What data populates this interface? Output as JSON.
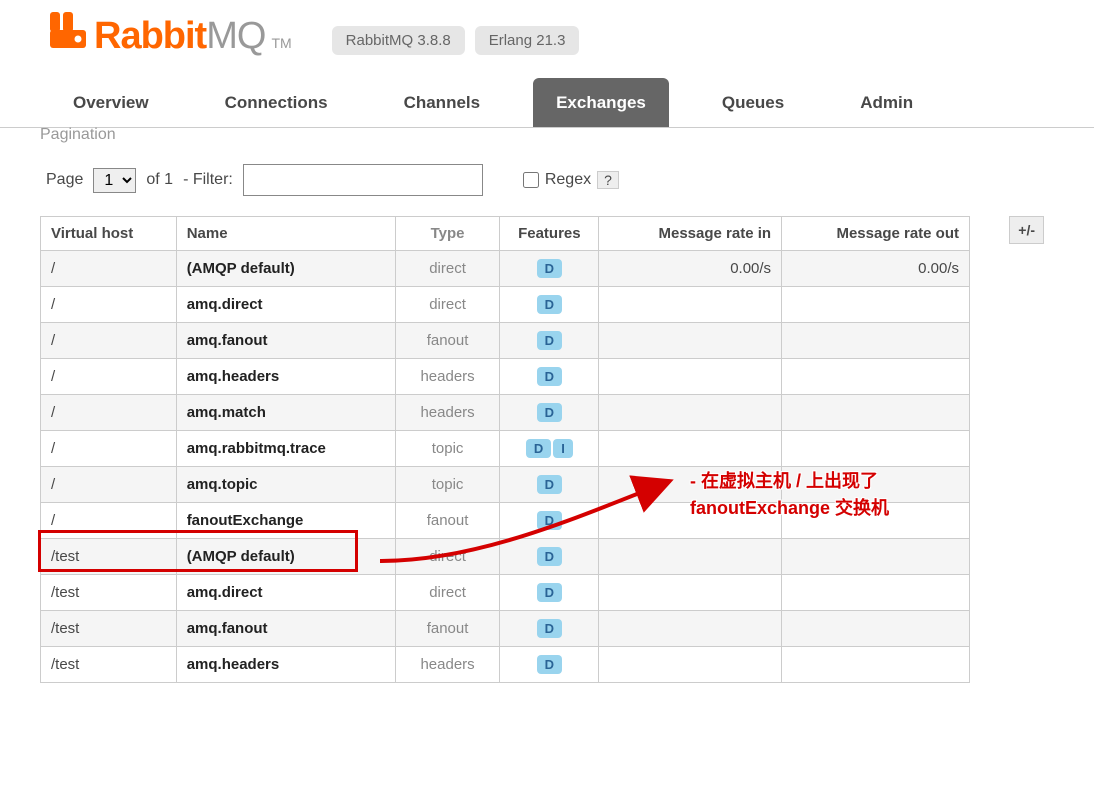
{
  "logo": {
    "rabbit": "Rabbit",
    "mq": "MQ",
    "tm": "TM"
  },
  "versions": {
    "rabbitmq": "RabbitMQ 3.8.8",
    "erlang": "Erlang 21.3"
  },
  "tabs": {
    "overview": "Overview",
    "connections": "Connections",
    "channels": "Channels",
    "exchanges": "Exchanges",
    "queues": "Queues",
    "admin": "Admin"
  },
  "section": "Pagination",
  "pagination": {
    "page_label": "Page",
    "page_value": "1",
    "of_label": "of 1",
    "filter_label": "- Filter:",
    "filter_value": "",
    "regex_label": "Regex",
    "help": "?"
  },
  "table": {
    "plus_minus": "+/-",
    "headers": {
      "vhost": "Virtual host",
      "name": "Name",
      "type": "Type",
      "features": "Features",
      "rate_in": "Message rate in",
      "rate_out": "Message rate out"
    },
    "rows": [
      {
        "vhost": "/",
        "name": "(AMQP default)",
        "type": "direct",
        "features": [
          "D"
        ],
        "rate_in": "0.00/s",
        "rate_out": "0.00/s"
      },
      {
        "vhost": "/",
        "name": "amq.direct",
        "type": "direct",
        "features": [
          "D"
        ],
        "rate_in": "",
        "rate_out": ""
      },
      {
        "vhost": "/",
        "name": "amq.fanout",
        "type": "fanout",
        "features": [
          "D"
        ],
        "rate_in": "",
        "rate_out": ""
      },
      {
        "vhost": "/",
        "name": "amq.headers",
        "type": "headers",
        "features": [
          "D"
        ],
        "rate_in": "",
        "rate_out": ""
      },
      {
        "vhost": "/",
        "name": "amq.match",
        "type": "headers",
        "features": [
          "D"
        ],
        "rate_in": "",
        "rate_out": ""
      },
      {
        "vhost": "/",
        "name": "amq.rabbitmq.trace",
        "type": "topic",
        "features": [
          "D",
          "I"
        ],
        "rate_in": "",
        "rate_out": ""
      },
      {
        "vhost": "/",
        "name": "amq.topic",
        "type": "topic",
        "features": [
          "D"
        ],
        "rate_in": "",
        "rate_out": ""
      },
      {
        "vhost": "/",
        "name": "fanoutExchange",
        "type": "fanout",
        "features": [
          "D"
        ],
        "rate_in": "",
        "rate_out": ""
      },
      {
        "vhost": "/test",
        "name": "(AMQP default)",
        "type": "direct",
        "features": [
          "D"
        ],
        "rate_in": "",
        "rate_out": ""
      },
      {
        "vhost": "/test",
        "name": "amq.direct",
        "type": "direct",
        "features": [
          "D"
        ],
        "rate_in": "",
        "rate_out": ""
      },
      {
        "vhost": "/test",
        "name": "amq.fanout",
        "type": "fanout",
        "features": [
          "D"
        ],
        "rate_in": "",
        "rate_out": ""
      },
      {
        "vhost": "/test",
        "name": "amq.headers",
        "type": "headers",
        "features": [
          "D"
        ],
        "rate_in": "",
        "rate_out": ""
      }
    ]
  },
  "annotation": {
    "line1": "- 在虚拟主机 / 上出现了",
    "line2": "fanoutExchange 交换机"
  }
}
